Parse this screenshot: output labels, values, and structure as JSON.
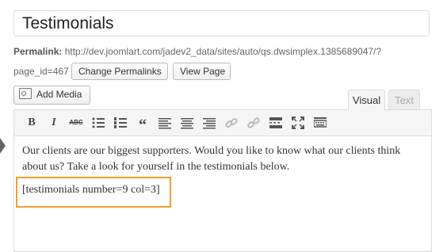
{
  "post": {
    "title": "Testimonials",
    "permalink_label": "Permalink:",
    "permalink_url": "http://dev.joomlart.com/jadev2_data/sites/auto/qs.dwsimplex.1385689047/?",
    "page_id": "page_id=467"
  },
  "buttons": {
    "change_permalinks": "Change Permalinks",
    "view_page": "View Page",
    "add_media": "Add Media"
  },
  "tabs": {
    "visual": "Visual",
    "text": "Text"
  },
  "toolbar": {
    "bold": "B",
    "italic": "I",
    "strikethrough": "ABC",
    "blockquote": "“"
  },
  "content": {
    "paragraph": "Our clients are our biggest supporters. Would you like to know what our clients think about us? Take a look for yourself in the testimonials below.",
    "shortcode": "[testimonials number=9 col=3]"
  },
  "colors": {
    "highlight": "#f0a030"
  }
}
